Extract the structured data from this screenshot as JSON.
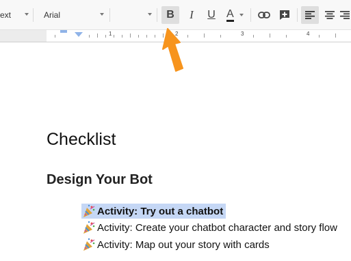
{
  "toolbar": {
    "style_dropdown_value": "ext",
    "font_dropdown_value": "Arial",
    "size_dropdown_value": "",
    "bold_label": "B",
    "italic_label": "I",
    "underline_label": "U",
    "text_color_label": "A",
    "text_color": "#222222"
  },
  "ruler": {
    "numbers": [
      "1",
      "2",
      "3",
      "4"
    ]
  },
  "document": {
    "title": "Checklist",
    "heading": "Design Your Bot",
    "items": [
      {
        "emoji": "party-popper-icon",
        "text": "Activity: Try out a chatbot"
      },
      {
        "emoji": "party-popper-icon",
        "text": "Activity: Create your chatbot character and story flow"
      },
      {
        "emoji": "party-popper-icon",
        "text": "Activity: Map out your story with cards"
      }
    ]
  },
  "annotation": {
    "arrow_color": "#f7941d"
  }
}
